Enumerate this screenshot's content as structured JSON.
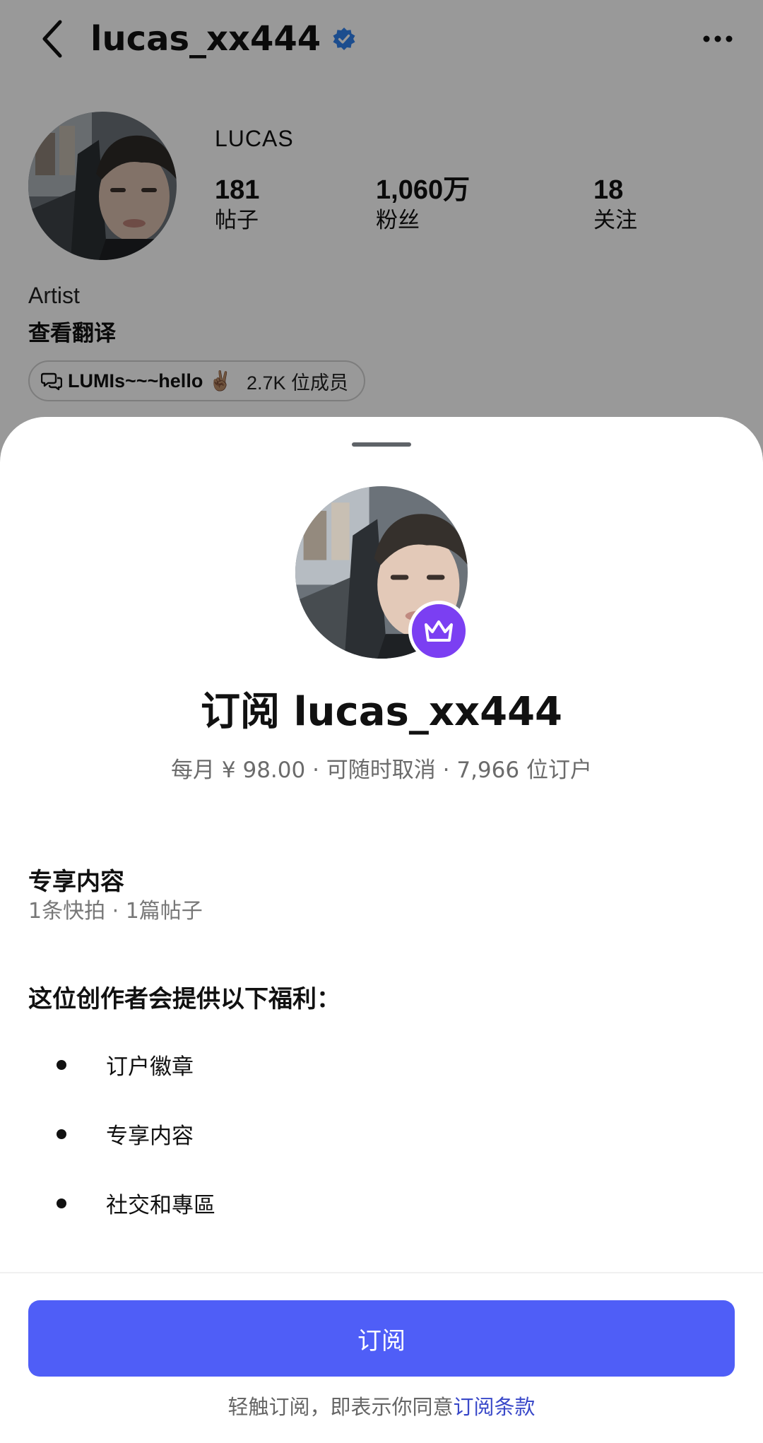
{
  "header": {
    "username": "lucas_xx444"
  },
  "profile": {
    "display_name": "LUCAS",
    "stats": [
      {
        "value": "181",
        "label": "帖子"
      },
      {
        "value": "1,060万",
        "label": "粉丝"
      },
      {
        "value": "18",
        "label": "关注"
      }
    ],
    "bio_role": "Artist",
    "bio_translate": "查看翻译",
    "channel": {
      "title": "LUMIs~~~hello",
      "emoji": "✌🏽",
      "members": "2.7K 位成员"
    }
  },
  "sheet": {
    "title": "订阅 lucas_xx444",
    "subtitle": "每月 ¥ 98.00 · 可随时取消 · 7,966 位订户",
    "exclusive": {
      "title": "专享内容",
      "detail": "1条快拍 · 1篇帖子"
    },
    "benefits_title": "这位创作者会提供以下福利：",
    "benefits": [
      "订户徽章",
      "专享内容",
      "社交和專區"
    ],
    "subscribe_label": "订阅",
    "terms_prefix": "轻触订阅，即表示你同意",
    "terms_link": "订阅条款"
  },
  "colors": {
    "subscribe_button": "#4f5ef7",
    "crown_badge": "#7b3ff2",
    "verified": "#2f80ed",
    "terms_link": "#3a49c9"
  },
  "icons": [
    "back-arrow-icon",
    "verified-badge-icon",
    "more-options-icon",
    "chat-bubbles-icon",
    "crown-icon"
  ]
}
